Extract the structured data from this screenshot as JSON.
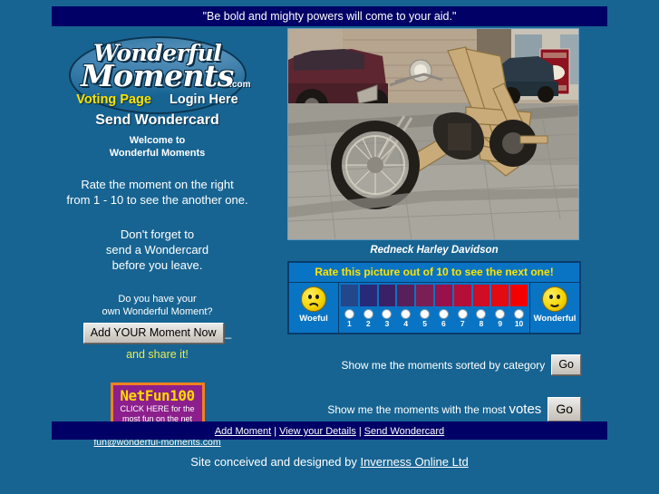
{
  "banner": {
    "quote": "\"Be bold and mighty powers will come to your aid.\""
  },
  "logo": {
    "word1": "Wonderful",
    "word2": "Moments",
    "dotcom": ".com",
    "voting_page": "Voting Page",
    "login_here": "Login Here",
    "send_wondercard": "Send Wondercard",
    "welcome_line1": "Welcome to",
    "welcome_line2": "Wonderful Moments"
  },
  "intro": {
    "line1": "Rate the moment on the right",
    "line2": "from 1 - 10 to see the another one.",
    "wc_line1": "Don't forget to",
    "wc_line2": "send a Wondercard",
    "wc_line3": "before you leave.",
    "own_line1": "Do you have your",
    "own_line2": "own Wonderful Moment?",
    "add_button": "Add YOUR Moment Now",
    "add_button_suffix": "_",
    "share_it": "and share it!"
  },
  "netfun": {
    "title": "NetFun100",
    "line1": "CLICK HERE for the",
    "line2": "most fun on the net"
  },
  "contact": {
    "email": "fun@wonderful-moments.com"
  },
  "photo": {
    "caption": "Redneck Harley Davidson",
    "alt": "Homemade wooden-framed chopper motorcycle parked on a cobbled street"
  },
  "rating": {
    "title": "Rate this picture out of 10 to see the next one!",
    "woeful_label": "Woeful",
    "wonderful_label": "Wonderful",
    "numbers": [
      "1",
      "2",
      "3",
      "4",
      "5",
      "6",
      "7",
      "8",
      "9",
      "10"
    ],
    "swatch_colors": [
      "#24468a",
      "#282a78",
      "#3a2166",
      "#58205a",
      "#7a1f55",
      "#99114a",
      "#b40f38",
      "#cf0d25",
      "#e40a12",
      "#f40000"
    ],
    "selected": null
  },
  "actions": {
    "sorted_label": "Show me the moments sorted by category",
    "sorted_go": "Go",
    "votes_label_pre": "Show me the moments with the most ",
    "votes_label_big": "votes",
    "votes_go": "Go"
  },
  "footer": {
    "add_moment": "Add Moment",
    "view_details": "View your Details",
    "send_wondercard": "Send Wondercard",
    "separator": "|",
    "credit_text": "Site conceived and designed by ",
    "credit_link": "Inverness Online Ltd"
  },
  "colors": {
    "page_background": "#176492",
    "banner_navy": "#000066",
    "accent_yellow": "#ffe400",
    "share_yellow": "#e8ec4e",
    "rate_box_blue": "#0a74c4",
    "netfun_purple": "#8c1f8c",
    "netfun_orange_border": "#f08020",
    "netfun_title_yellow": "#ffd700"
  }
}
